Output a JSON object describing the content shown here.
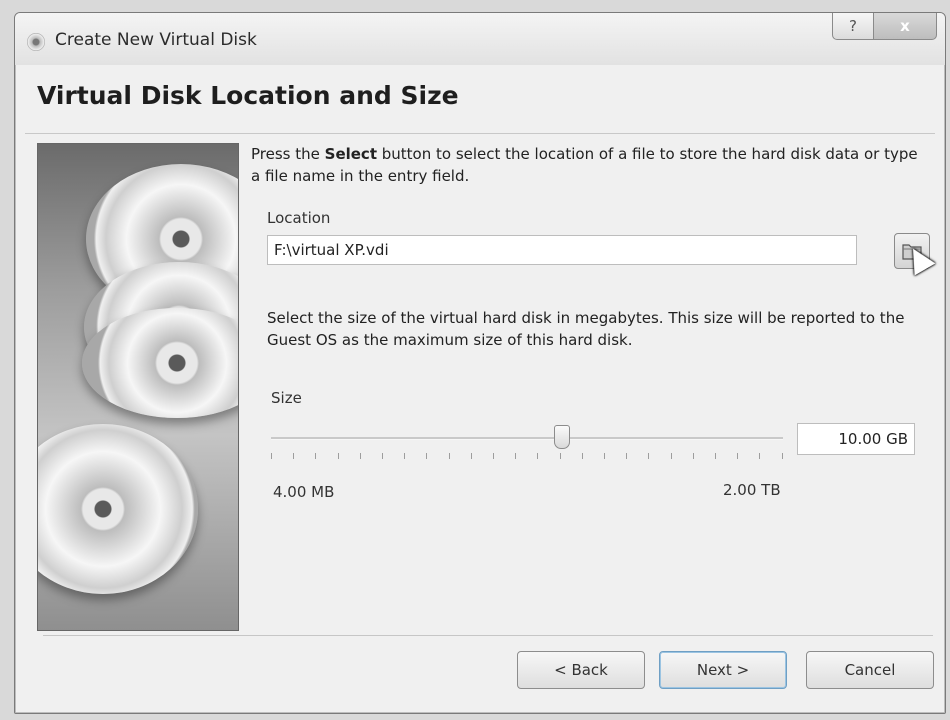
{
  "window": {
    "title": "Create New Virtual Disk",
    "help_symbol": "?",
    "close_symbol": "x"
  },
  "page": {
    "heading": "Virtual Disk Location and Size"
  },
  "location_section": {
    "description_prefix": "Press the ",
    "description_bold": "Select",
    "description_suffix": " button to select the location of a file to store the hard disk data or type a file name in the entry field.",
    "label": "Location",
    "value": "F:\\virtual XP.vdi"
  },
  "size_section": {
    "description": "Select the size of the virtual hard disk in megabytes. This size will be reported to the Guest OS as the maximum size of this hard disk.",
    "label": "Size",
    "value": "10.00 GB",
    "min_label": "4.00 MB",
    "max_label": "2.00 TB",
    "slider_position": 0.57
  },
  "buttons": {
    "back": "< Back",
    "next": "Next >",
    "cancel": "Cancel"
  }
}
